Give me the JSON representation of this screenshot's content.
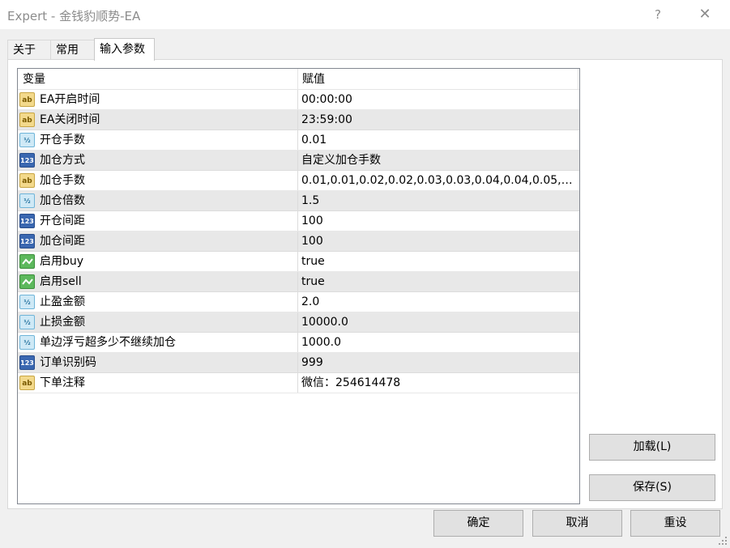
{
  "window": {
    "title": "Expert - 金钱豹顺势-EA",
    "help_glyph": "?",
    "close_glyph": "✕"
  },
  "tabs": [
    {
      "label": "关于"
    },
    {
      "label": "常用"
    },
    {
      "label": "输入参数"
    }
  ],
  "grid": {
    "col_variable": "变量",
    "col_value": "赋值",
    "rows": [
      {
        "type": "ab",
        "name": "EA开启时间",
        "value": "00:00:00"
      },
      {
        "type": "ab",
        "name": "EA关闭时间",
        "value": "23:59:00"
      },
      {
        "type": "half",
        "name": "开仓手数",
        "value": "0.01"
      },
      {
        "type": "123",
        "name": "加仓方式",
        "value": "自定义加仓手数"
      },
      {
        "type": "ab",
        "name": "加仓手数",
        "value": "0.01,0.01,0.02,0.02,0.03,0.03,0.04,0.04,0.05,0..."
      },
      {
        "type": "half",
        "name": "加仓倍数",
        "value": "1.5"
      },
      {
        "type": "123",
        "name": "开仓间距",
        "value": "100"
      },
      {
        "type": "123",
        "name": "加仓间距",
        "value": "100"
      },
      {
        "type": "bool",
        "name": "启用buy",
        "value": "true"
      },
      {
        "type": "bool",
        "name": "启用sell",
        "value": "true"
      },
      {
        "type": "half",
        "name": "止盈金额",
        "value": "2.0"
      },
      {
        "type": "half",
        "name": "止损金额",
        "value": "10000.0"
      },
      {
        "type": "half",
        "name": "单边浮亏超多少不继续加仓",
        "value": "1000.0"
      },
      {
        "type": "123",
        "name": "订单识别码",
        "value": "999"
      },
      {
        "type": "ab",
        "name": "下单注释",
        "value": "微信：254614478"
      }
    ]
  },
  "icons": {
    "ab": {
      "glyph": "ab",
      "semantic": "string-param-icon"
    },
    "half": {
      "glyph": "½",
      "semantic": "double-param-icon"
    },
    "123": {
      "glyph": "123",
      "semantic": "integer-param-icon"
    },
    "bool": {
      "glyph": "",
      "semantic": "bool-param-icon"
    }
  },
  "side_buttons": {
    "load": "加载(L)",
    "save": "保存(S)"
  },
  "footer_buttons": {
    "ok": "确定",
    "cancel": "取消",
    "reset": "重设"
  }
}
